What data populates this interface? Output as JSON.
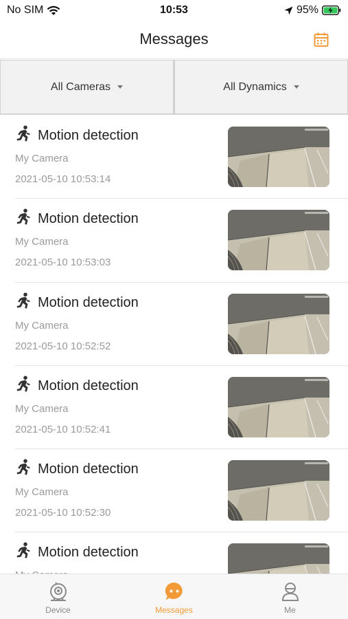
{
  "status": {
    "carrier": "No SIM",
    "time": "10:53",
    "battery": "95%"
  },
  "header": {
    "title": "Messages",
    "calendar_icon": "calendar-icon",
    "accent": "#f29a38"
  },
  "filters": {
    "cameras": "All Cameras",
    "dynamics": "All Dynamics"
  },
  "messages": [
    {
      "title": "Motion detection",
      "camera": "My Camera",
      "time": "2021-05-10 10:53:14"
    },
    {
      "title": "Motion detection",
      "camera": "My Camera",
      "time": "2021-05-10 10:53:03"
    },
    {
      "title": "Motion detection",
      "camera": "My Camera",
      "time": "2021-05-10 10:52:52"
    },
    {
      "title": "Motion detection",
      "camera": "My Camera",
      "time": "2021-05-10 10:52:41"
    },
    {
      "title": "Motion detection",
      "camera": "My Camera",
      "time": "2021-05-10 10:52:30"
    },
    {
      "title": "Motion detection",
      "camera": "My Camera",
      "time": ""
    }
  ],
  "tabs": [
    {
      "label": "Device",
      "icon": "camera-icon",
      "active": false
    },
    {
      "label": "Messages",
      "icon": "chat-bubble-icon",
      "active": true
    },
    {
      "label": "Me",
      "icon": "person-icon",
      "active": false
    }
  ]
}
